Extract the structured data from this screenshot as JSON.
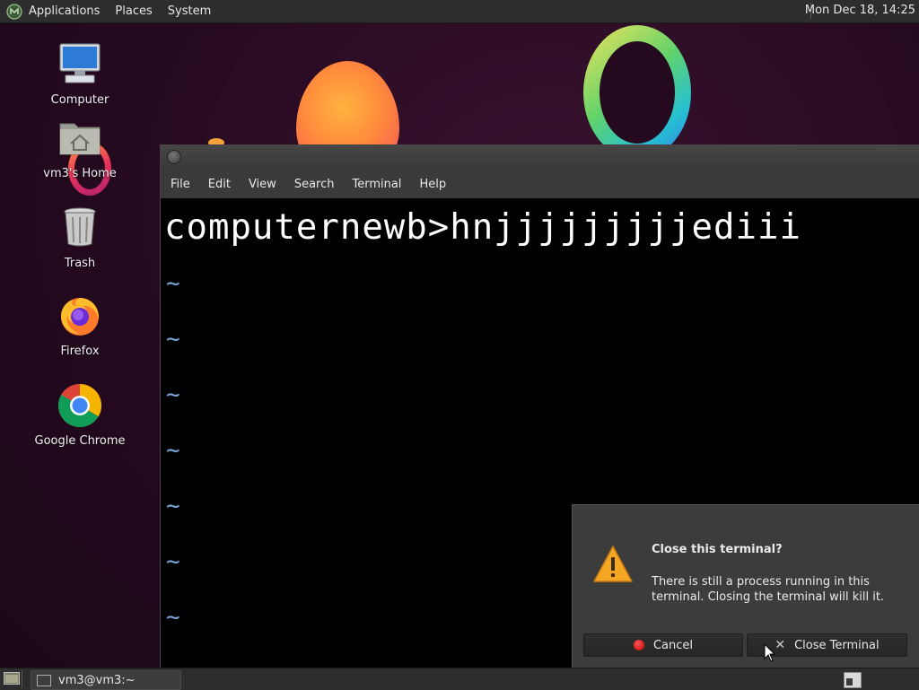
{
  "top_panel": {
    "menus": [
      "Applications",
      "Places",
      "System"
    ],
    "clock": "Mon Dec 18, 14:25"
  },
  "desktop": {
    "icons": [
      {
        "label": "Computer"
      },
      {
        "label": "vm3's Home"
      },
      {
        "label": "Trash"
      },
      {
        "label": "Firefox"
      },
      {
        "label": "Google Chrome"
      }
    ]
  },
  "terminal": {
    "menu": [
      "File",
      "Edit",
      "View",
      "Search",
      "Terminal",
      "Help"
    ],
    "prompt_line": "computernewb>hnjjjjjjjjjediii",
    "tilde": "~"
  },
  "dialog": {
    "title": "Close this terminal?",
    "message": "There is still a process running in this terminal. Closing the terminal will kill it.",
    "cancel_label": "Cancel",
    "close_label": "Close Terminal",
    "warning_icon": "warning-icon"
  },
  "bottom_panel": {
    "task_label": "vm3@vm3:~"
  },
  "colors": {
    "panel": "#2d2d2d",
    "terminal_bg": "#000000",
    "tilde": "#7aa7e0",
    "dialog_bg": "#3c3c3c",
    "warning": "#f5a623"
  }
}
